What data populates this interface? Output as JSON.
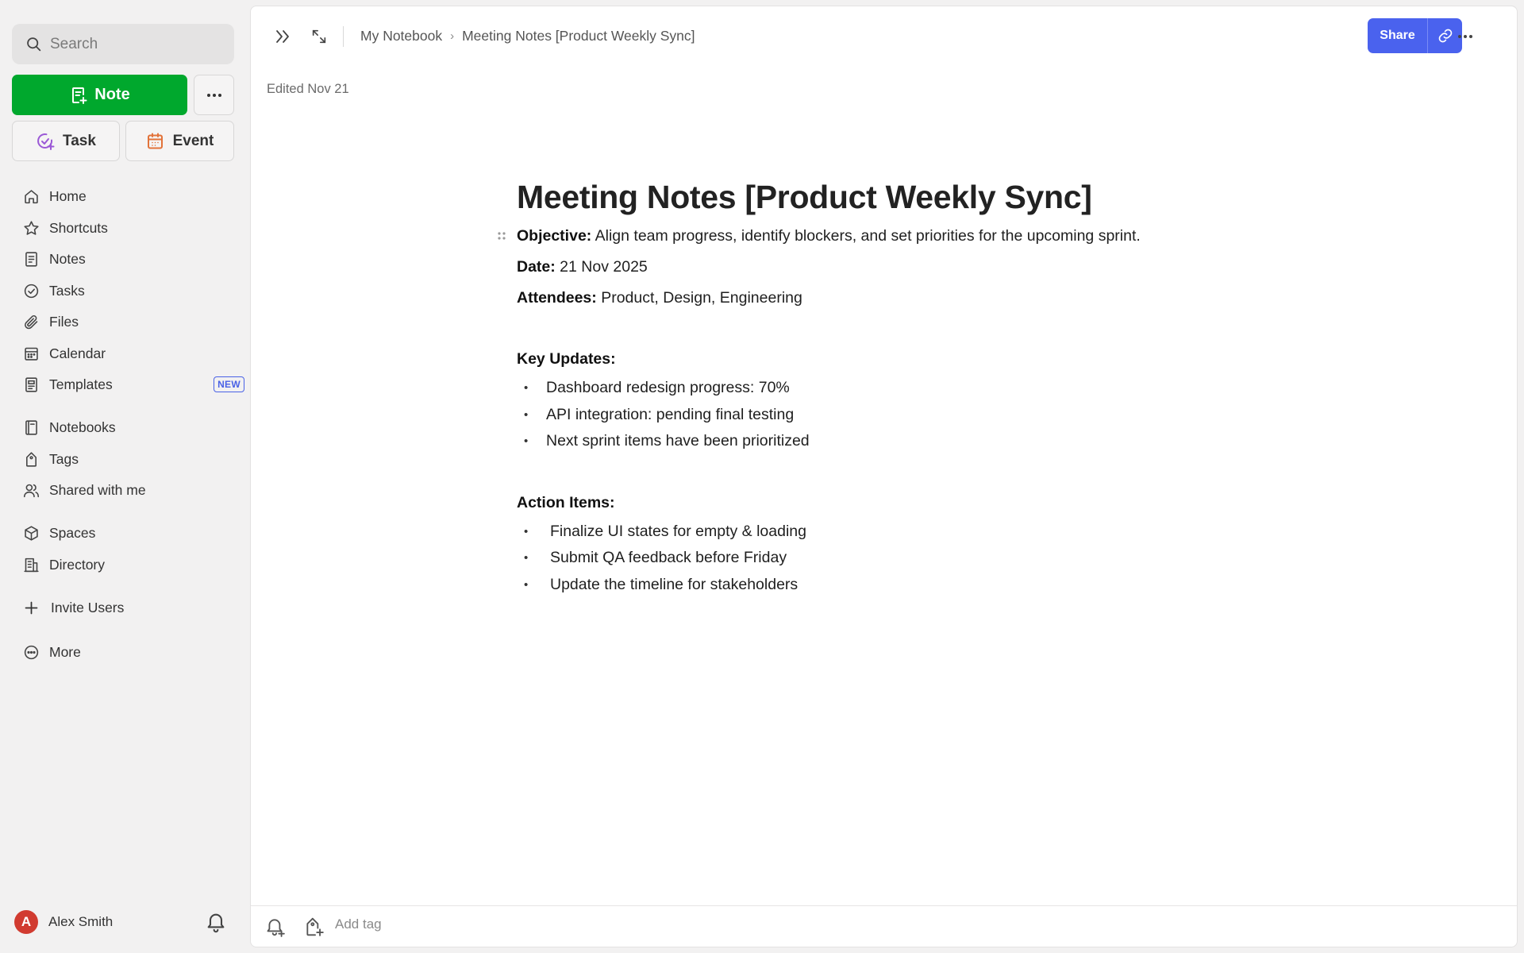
{
  "sidebar": {
    "search_placeholder": "Search",
    "new_note_label": "Note",
    "task_label": "Task",
    "event_label": "Event",
    "nav_primary": [
      {
        "label": "Home",
        "icon": "home-icon"
      },
      {
        "label": "Shortcuts",
        "icon": "star-icon"
      },
      {
        "label": "Notes",
        "icon": "note-icon"
      },
      {
        "label": "Tasks",
        "icon": "check-circle-icon"
      },
      {
        "label": "Files",
        "icon": "paperclip-icon"
      },
      {
        "label": "Calendar",
        "icon": "calendar-icon"
      },
      {
        "label": "Templates",
        "icon": "template-icon",
        "badge": "NEW"
      }
    ],
    "nav_secondary": [
      {
        "label": "Notebooks",
        "icon": "notebook-icon"
      },
      {
        "label": "Tags",
        "icon": "tag-icon"
      },
      {
        "label": "Shared with me",
        "icon": "users-icon"
      }
    ],
    "nav_tertiary": [
      {
        "label": "Spaces",
        "icon": "cube-icon"
      },
      {
        "label": "Directory",
        "icon": "building-icon"
      }
    ],
    "invite_label": "Invite Users",
    "more_label": "More",
    "user": {
      "initial": "A",
      "name": "Alex Smith"
    }
  },
  "topbar": {
    "breadcrumb": [
      "My Notebook",
      "Meeting Notes [Product Weekly Sync]"
    ],
    "share_label": "Share"
  },
  "note": {
    "edited": "Edited Nov 21",
    "title": "Meeting Notes [Product Weekly Sync]",
    "objective_label": "Objective:",
    "objective_text": " Align team progress, identify blockers, and set priorities for the upcoming sprint.",
    "date_label": "Date:",
    "date_text": " 21 Nov 2025",
    "attendees_label": "Attendees:",
    "attendees_text": " Product, Design, Engineering",
    "key_updates_heading": "Key Updates:",
    "key_updates": [
      "Dashboard redesign progress: 70%",
      "API integration: pending final testing",
      "Next sprint items have been prioritized"
    ],
    "action_items_heading": "Action Items:",
    "action_items": [
      "Finalize UI states for empty & loading",
      "Submit QA feedback before Friday",
      "Update the timeline for stakeholders"
    ]
  },
  "footer": {
    "add_tag_placeholder": "Add tag"
  },
  "colors": {
    "brand_green": "#00a82d",
    "share_blue": "#4a62ee",
    "avatar_red": "#d13b30"
  }
}
